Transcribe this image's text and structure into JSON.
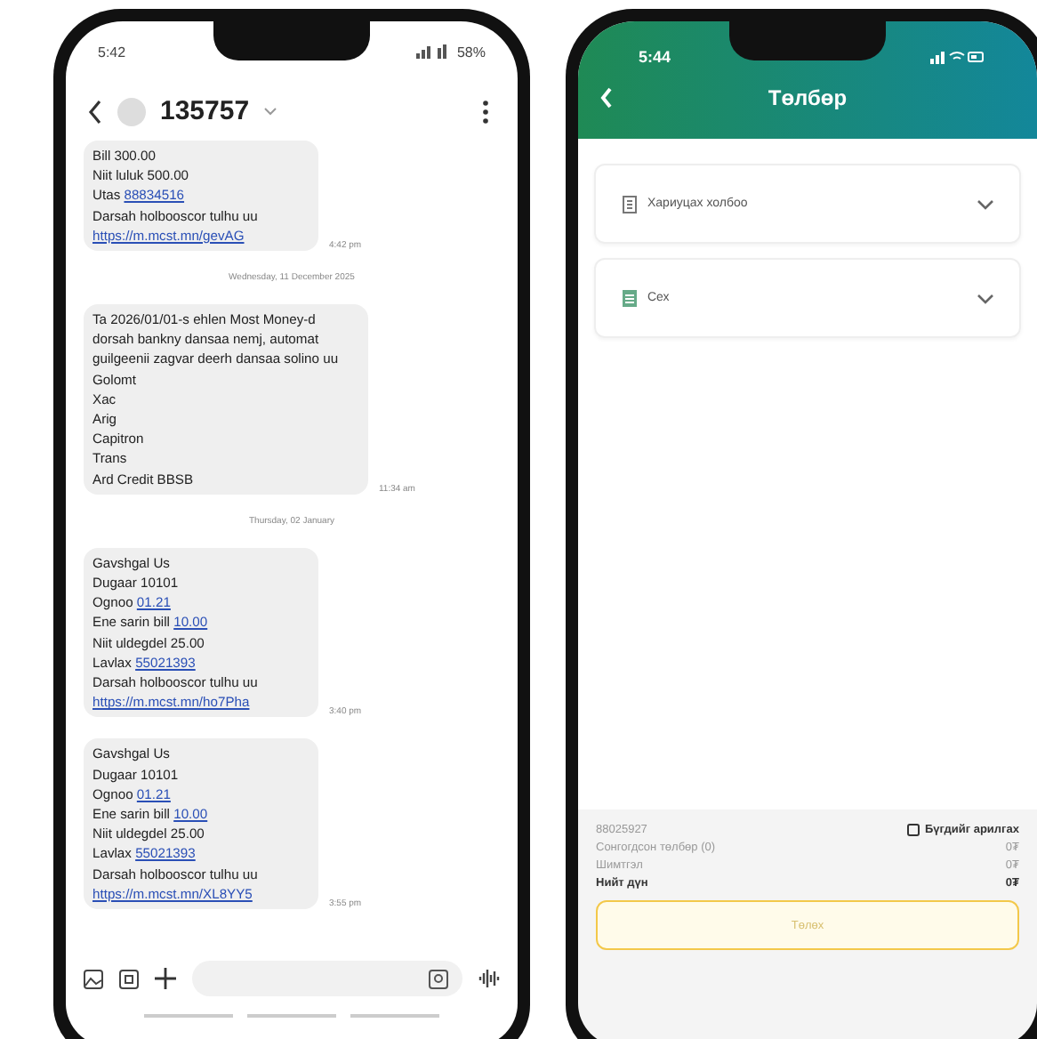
{
  "sms_phone": {
    "status_bar": {
      "time": "5:42",
      "battery": "58%"
    },
    "contact": {
      "title": "135757"
    },
    "thread": [
      {
        "kind": "message",
        "time": "4:42 pm",
        "lines": [
          {
            "text": "Bill 300.00"
          },
          {
            "text": "Niit luluk 500.00"
          },
          {
            "text": "Utas ",
            "link": "88834516"
          },
          {
            "text": "Darsah holbooscor tulhu uu"
          },
          {
            "link": "https://m.mcst.mn/gevAG"
          }
        ]
      },
      {
        "kind": "date",
        "text": "Wednesday, 11 December 2025"
      },
      {
        "kind": "message",
        "time": "11:34 am",
        "lines": [
          {
            "text": "Ta 2026/01/01-s ehlen Most Money-d dorsah bankny dansaa nemj, automat guilgeenii zagvar deerh dansaa solino uu"
          },
          {
            "text": "Golomt"
          },
          {
            "text": "Xac"
          },
          {
            "text": "Arig"
          },
          {
            "text": "Capitron"
          },
          {
            "text": "Trans"
          },
          {
            "text": "Ard Credit BBSB"
          }
        ]
      },
      {
        "kind": "date",
        "text": "Thursday, 02 January"
      },
      {
        "kind": "message",
        "time": "3:40 pm",
        "lines": [
          {
            "text": "Gavshgal Us"
          },
          {
            "text": "Dugaar 10101"
          },
          {
            "text": "Ognoo ",
            "link": "01.21"
          },
          {
            "text": "Ene sarin bill ",
            "link": "10.00"
          },
          {
            "text": "Niit uldegdel 25.00"
          },
          {
            "text": "Lavlax ",
            "link": "55021393"
          },
          {
            "text": "Darsah holbooscor tulhu uu"
          },
          {
            "link": "https://m.mcst.mn/ho7Pha"
          }
        ]
      },
      {
        "kind": "message",
        "time": "3:55 pm",
        "lines": [
          {
            "text": "Gavshgal Us"
          },
          {
            "text": "Dugaar 10101"
          },
          {
            "text": "Ognoo ",
            "link": "01.21"
          },
          {
            "text": "Ene sarin bill ",
            "link": "10.00"
          },
          {
            "text": "Niit uldegdel 25.00"
          },
          {
            "text": "Lavlax ",
            "link": "55021393"
          },
          {
            "text": "Darsah holbooscor tulhu uu"
          },
          {
            "link": "https://m.mcst.mn/XL8YY5"
          }
        ]
      }
    ]
  },
  "payment_phone": {
    "status_bar": {
      "time": "5:44"
    },
    "header": {
      "title": "Төлбөр"
    },
    "selects": [
      {
        "kind": "contract",
        "label": "Хариуцах холбоо"
      },
      {
        "kind": "account",
        "label": "Сех"
      }
    ],
    "summary": {
      "account_number": "88025927",
      "clear_all": "Бүгдийг арилгах",
      "rows": [
        {
          "label": "Сонгогдсон төлбөр (0)",
          "value": "0₮",
          "bold": false
        },
        {
          "label": "Шимтгэл",
          "value": "0₮",
          "bold": false
        },
        {
          "label": "Нийт дүн",
          "value": "0₮",
          "bold": true
        }
      ],
      "pay_button": {
        "label": "Төлөх",
        "disabled": true
      }
    }
  }
}
